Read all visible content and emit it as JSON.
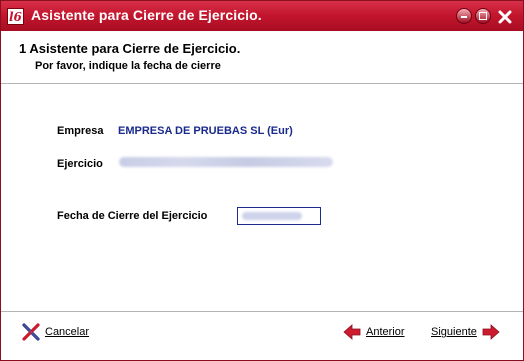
{
  "window": {
    "title": "Asistente para Cierre de Ejercicio.",
    "app_icon_text": "l6"
  },
  "header": {
    "step_title": "1 Asistente para Cierre de Ejercicio.",
    "step_subtitle": "Por favor, indique la fecha de cierre"
  },
  "form": {
    "empresa_label": "Empresa",
    "empresa_value": "EMPRESA DE PRUEBAS SL (Eur)",
    "ejercicio_label": "Ejercicio",
    "fecha_label": "Fecha de Cierre del Ejercicio"
  },
  "buttons": {
    "cancel": "Cancelar",
    "previous": "Anterior",
    "next": "Siguiente"
  },
  "colors": {
    "titlebar": "#c4162f",
    "value_text": "#1a2a8c",
    "arrow_icon": "#cc1a2e"
  }
}
